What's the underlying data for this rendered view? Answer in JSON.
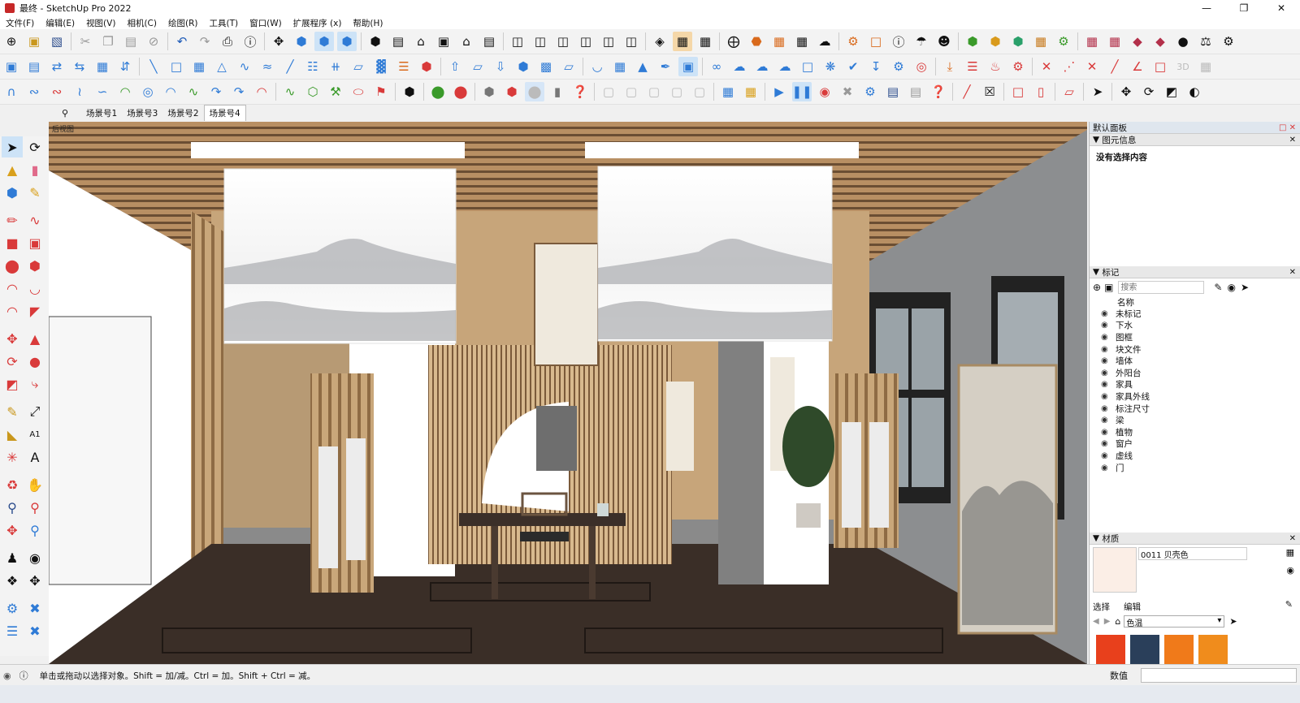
{
  "window": {
    "title": "最终 - SketchUp Pro 2022",
    "minimize_icon": "minimize-icon",
    "maximize_icon": "maximize-icon",
    "close_icon": "close-icon"
  },
  "menu": [
    "文件(F)",
    "编辑(E)",
    "视图(V)",
    "相机(C)",
    "绘图(R)",
    "工具(T)",
    "窗口(W)",
    "扩展程序 (x)",
    "帮助(H)"
  ],
  "scenes": {
    "tabs": [
      "场景号1",
      "场景号3",
      "场景号2",
      "场景号4"
    ],
    "active": 3
  },
  "viewport": {
    "label": "后视图"
  },
  "panel": {
    "title": "默认面板",
    "entity_info": {
      "header": "图元信息",
      "text": "没有选择内容"
    },
    "tags": {
      "header": "标记",
      "search_placeholder": "搜索",
      "column": "名称",
      "items": [
        "未标记",
        "下水",
        "图框",
        "块文件",
        "墙体",
        "外阳台",
        "家具",
        "家具外线",
        "标注尺寸",
        "梁",
        "植物",
        "窗户",
        "虚线",
        "门"
      ]
    },
    "materials": {
      "header": "材质",
      "current": "0011 贝壳色",
      "tab_select": "选择",
      "tab_edit": "编辑",
      "library": "色温",
      "swatch_colors": [
        "#e8401c",
        "#2a3f5a",
        "#f07a1a",
        "#f08c1c"
      ]
    }
  },
  "status": {
    "hint": "单击或拖动以选择对象。Shift = 加/减。Ctrl = 加。Shift + Ctrl = 减。",
    "measurements_label": "数值"
  },
  "colors": {
    "accent": "#1e6fd9",
    "floor": "#3a2e27",
    "wood": "#c9a77a",
    "ceiling": "#a8845c"
  }
}
